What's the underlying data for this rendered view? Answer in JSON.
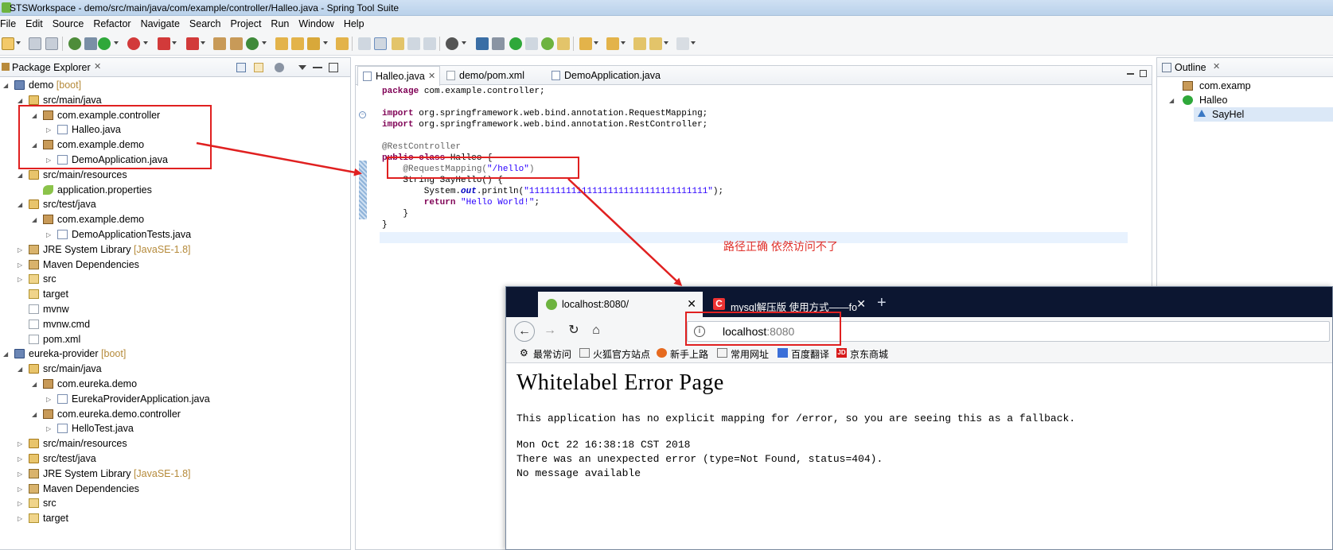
{
  "window": {
    "title": "STSWorkspace - demo/src/main/java/com/example/controller/Halleo.java - Spring Tool Suite"
  },
  "menu": [
    "File",
    "Edit",
    "Source",
    "Refactor",
    "Navigate",
    "Search",
    "Project",
    "Run",
    "Window",
    "Help"
  ],
  "package_explorer": {
    "title": "Package Explorer",
    "tree": [
      {
        "label": "demo",
        "deco": "[boot]",
        "icon": "project-icon"
      },
      {
        "label": "src/main/java",
        "icon": "source-folder-icon"
      },
      {
        "label": "com.example.controller",
        "icon": "package-icon"
      },
      {
        "label": "Halleo.java",
        "icon": "java-file-icon"
      },
      {
        "label": "com.example.demo",
        "icon": "package-icon"
      },
      {
        "label": "DemoApplication.java",
        "icon": "java-file-icon"
      },
      {
        "label": "src/main/resources",
        "icon": "source-folder-icon"
      },
      {
        "label": "application.properties",
        "icon": "properties-icon"
      },
      {
        "label": "src/test/java",
        "icon": "source-folder-icon"
      },
      {
        "label": "com.example.demo",
        "icon": "package-icon"
      },
      {
        "label": "DemoApplicationTests.java",
        "icon": "java-file-icon"
      },
      {
        "label": "JRE System Library",
        "deco": "[JavaSE-1.8]",
        "icon": "library-icon"
      },
      {
        "label": "Maven Dependencies",
        "icon": "library-icon"
      },
      {
        "label": "src",
        "icon": "folder-icon"
      },
      {
        "label": "target",
        "icon": "folder-icon"
      },
      {
        "label": "mvnw",
        "icon": "file-icon"
      },
      {
        "label": "mvnw.cmd",
        "icon": "file-icon"
      },
      {
        "label": "pom.xml",
        "icon": "xml-file-icon"
      },
      {
        "label": "eureka-provider",
        "deco": "[boot]",
        "icon": "project-icon"
      },
      {
        "label": "src/main/java",
        "icon": "source-folder-icon"
      },
      {
        "label": "com.eureka.demo",
        "icon": "package-icon"
      },
      {
        "label": "EurekaProviderApplication.java",
        "icon": "java-file-icon"
      },
      {
        "label": "com.eureka.demo.controller",
        "icon": "package-icon"
      },
      {
        "label": "HelloTest.java",
        "icon": "java-file-icon"
      },
      {
        "label": "src/main/resources",
        "icon": "source-folder-icon"
      },
      {
        "label": "src/test/java",
        "icon": "source-folder-icon"
      },
      {
        "label": "JRE System Library",
        "deco": "[JavaSE-1.8]",
        "icon": "library-icon"
      },
      {
        "label": "Maven Dependencies",
        "icon": "library-icon"
      },
      {
        "label": "src",
        "icon": "folder-icon"
      },
      {
        "label": "target",
        "icon": "folder-icon"
      }
    ]
  },
  "editor": {
    "tabs": [
      {
        "label": "Halleo.java",
        "active": true
      },
      {
        "label": "demo/pom.xml",
        "active": false
      },
      {
        "label": "DemoApplication.java",
        "active": false
      }
    ],
    "code": {
      "l1_kw": "package",
      "l1_rest": " com.example.controller;",
      "l3_kw": "import",
      "l3_rest": " org.springframework.web.bind.annotation.RequestMapping;",
      "l4_kw": "import",
      "l4_rest": " org.springframework.web.bind.annotation.RestController;",
      "l6_ann": "@RestController",
      "l7_kw1": "public",
      "l7_kw2": "class",
      "l7_rest": " Halleo {",
      "l8_ann": "    @RequestMapping(",
      "l8_str": "\"/hello\"",
      "l8_end": ")",
      "l9_type": "    String",
      "l9_rest": " SayHello() {",
      "l10_pre": "        System.",
      "l10_fld": "out",
      "l10_mid": ".println(",
      "l10_str": "\"1111111111111111111111111111111111\"",
      "l10_end": ");",
      "l11_kw": "        return",
      "l11_str": " \"Hello World!\"",
      "l11_end": ";",
      "l12": "    }",
      "l13": "}"
    }
  },
  "annotation_note": "路径正确 依然访问不了",
  "outline": {
    "title": "Outline",
    "items": [
      "com.examp",
      "Halleo",
      "SayHel"
    ]
  },
  "browser": {
    "tabs": [
      {
        "label": "localhost:8080/"
      },
      {
        "label": "mysql解压版 使用方式——fo"
      }
    ],
    "url_host": "localhost",
    "url_port": ":8080",
    "bookmarks": [
      "最常访问",
      "火狐官方站点",
      "新手上路",
      "常用网址",
      "百度翻译",
      "京东商城"
    ],
    "page": {
      "heading": "Whitelabel Error Page",
      "line1": "This application has no explicit mapping for /error, so you are seeing this as a fallback.",
      "line2": "Mon Oct 22 16:38:18 CST 2018",
      "line3": "There was an unexpected error (type=Not Found, status=404).",
      "line4": "No message available"
    }
  },
  "colors": {
    "annotation_red": "#e02020",
    "keyword": "#7f0055",
    "string": "#2a00ff",
    "browser_dark": "#0c1631"
  }
}
